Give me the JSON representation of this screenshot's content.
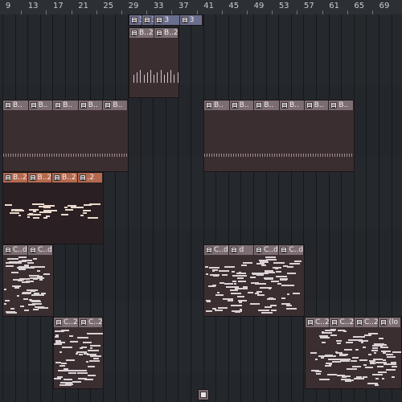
{
  "ruler": {
    "bars": [
      "9",
      "13",
      "17",
      "21",
      "25",
      "29",
      "33",
      "37",
      "41",
      "45",
      "49",
      "53",
      "57",
      "61",
      "65",
      "69"
    ]
  },
  "tracks": {
    "top_clip": {
      "labels": [
        "3",
        "3",
        "3",
        "3"
      ],
      "color": "#6b6f8e"
    },
    "b_clip_top": {
      "labels": [
        "B..2",
        "B..2"
      ],
      "color": "#7b6d71"
    },
    "b_clips_row3_left": {
      "labels": [
        "B..",
        "B..",
        "B..",
        "B..",
        "B.."
      ],
      "color": "#7b6d71"
    },
    "b_clips_row3_right": {
      "labels": [
        "B..",
        "B..",
        "B..",
        "B..",
        "B..",
        "B.."
      ],
      "color": "#7b6d71"
    },
    "orange_clip": {
      "labels": [
        "B..2",
        "B..2",
        "B..2",
        ".2"
      ],
      "color": "#b4694e"
    },
    "c_clip_left": {
      "labels": [
        "C..d",
        "C..d"
      ],
      "color": "#7b6d71"
    },
    "c_clip_right": {
      "labels": [
        "C..d",
        "d",
        "C..d",
        "C..d"
      ],
      "color": "#7b6d71"
    },
    "c2_clip_left": {
      "labels": [
        "C..2",
        "C..2"
      ],
      "color": "#7b6d71"
    },
    "c2_clip_right": {
      "labels": [
        "C..2",
        "C..2",
        "C..2",
        "(lo"
      ],
      "color": "#7b6d71"
    }
  },
  "icons": {
    "clip_icon": "pattern-icon"
  }
}
